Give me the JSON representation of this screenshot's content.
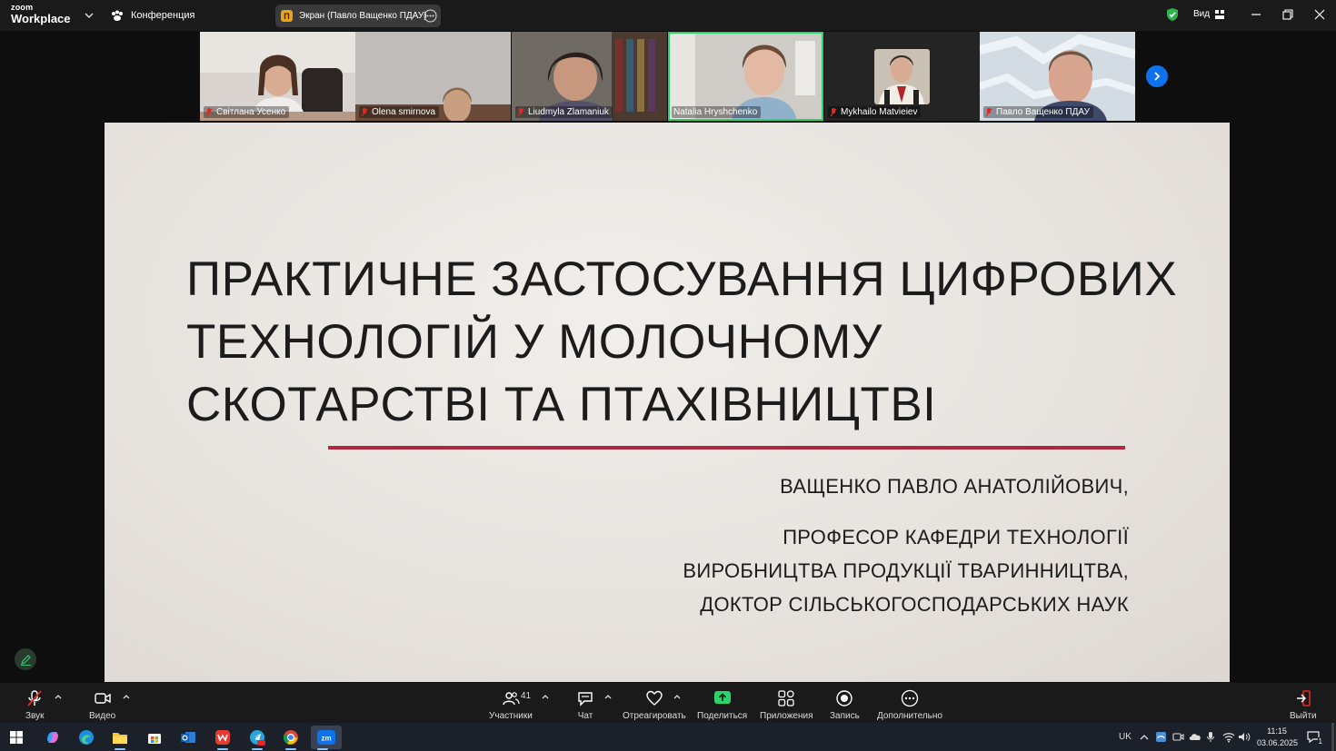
{
  "app": {
    "logo_small": "zoom",
    "logo_big": "Workplace",
    "meeting_label": "Конференция",
    "share_badge_letter": "П",
    "share_label": "Экран (Павло Ващенко ПДАУ)",
    "view_label": "Вид"
  },
  "participants": [
    {
      "name": "Світлана Усенко"
    },
    {
      "name": "Olena smirnova"
    },
    {
      "name": "Liudmyla Zlamaniuk"
    },
    {
      "name": "Natalia Hryshchenko",
      "active": true
    },
    {
      "name": "Mykhailo Matvieiev"
    },
    {
      "name": "Павло Ващенко ПДАУ"
    }
  ],
  "slide": {
    "title_lines": [
      "ПРАКТИЧНЕ ЗАСТОСУВАННЯ ЦИФРОВИХ",
      "ТЕХНОЛОГІЙ У МОЛОЧНОМУ",
      "СКОТАРСТВІ ТА ПТАХІВНИЦТВІ"
    ],
    "author": "ВАЩЕНКО ПАВЛО АНАТОЛІЙОВИЧ,",
    "role_lines": [
      "ПРОФЕСОР КАФЕДРИ ТЕХНОЛОГІЇ",
      "ВИРОБНИЦТВА ПРОДУКЦІЇ ТВАРИННИЦТВА,",
      "ДОКТОР СІЛЬСЬКОГОСПОДАРСЬКИХ НАУК"
    ],
    "rule_color": "#b3243d"
  },
  "toolbar": {
    "audio": "Звук",
    "video": "Видео",
    "participants": "Участники",
    "participants_count": "41",
    "chat": "Чат",
    "react": "Отреагировать",
    "share": "Поделиться",
    "apps": "Приложения",
    "record": "Запись",
    "more": "Дополнительно",
    "leave": "Выйти"
  },
  "taskbar": {
    "lang": "UK",
    "time": "11:15",
    "date": "03.06.2025",
    "notifications": "1"
  },
  "colors": {
    "accent_green": "#2bd36d",
    "zoom_blue": "#0e72ed",
    "share_green": "#2bd36d",
    "leave_red": "#e02828"
  }
}
